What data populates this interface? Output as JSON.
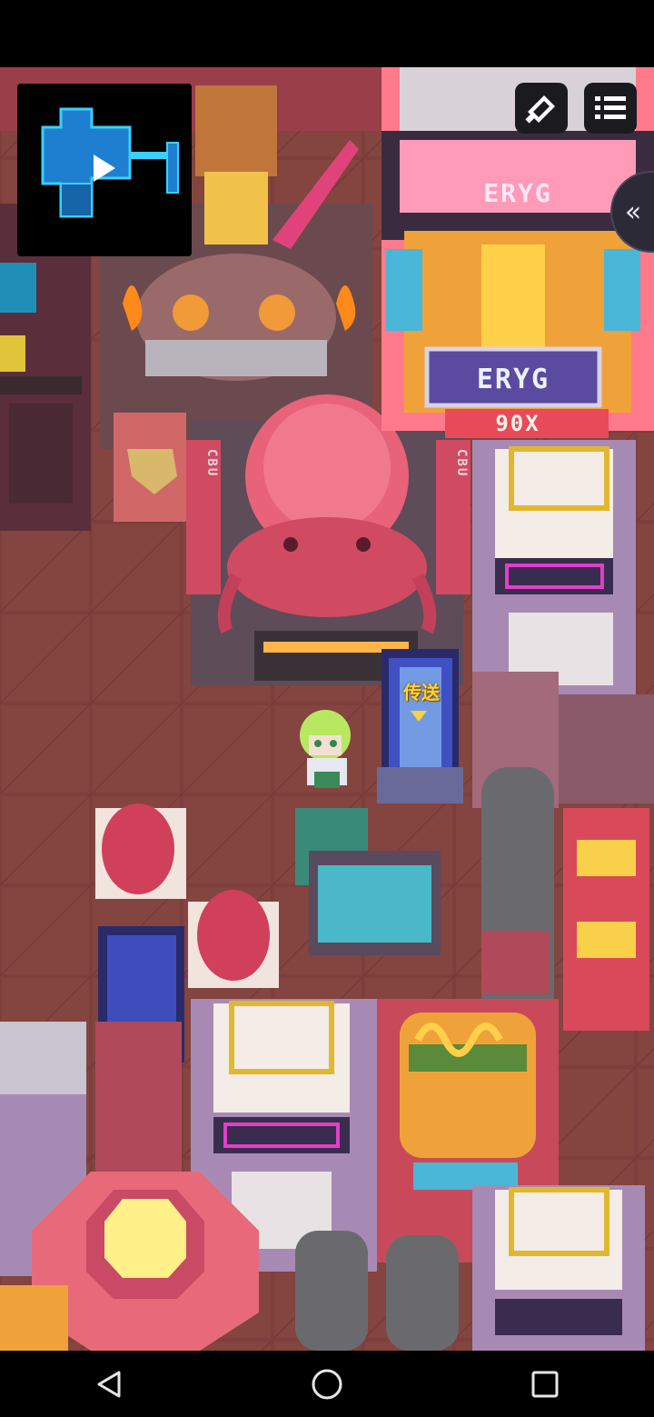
{
  "hud": {
    "collapse_glyph": "«",
    "icons": {
      "map_marker": "map-marker-icon",
      "menu": "menu-list-icon",
      "collapse": "chevron-double-left-icon",
      "player": "player-arrow-icon"
    }
  },
  "world": {
    "tower_sign_top": "ERYG",
    "tower_sign_panel": "ERYG",
    "tower_sign_bottom": "90X",
    "portal_label": "传送",
    "banner_text_left": "CBU",
    "banner_text_right": "CBU"
  },
  "colors": {
    "floor": "#7a3f3f",
    "minimap_room": "#1e7fd0",
    "minimap_outline": "#3ad0ff",
    "portal_glow": "#4fb6ff",
    "accent_yellow": "#ffd23a"
  },
  "system_nav": {
    "back": "back-icon",
    "home": "home-icon",
    "recents": "recents-icon"
  }
}
